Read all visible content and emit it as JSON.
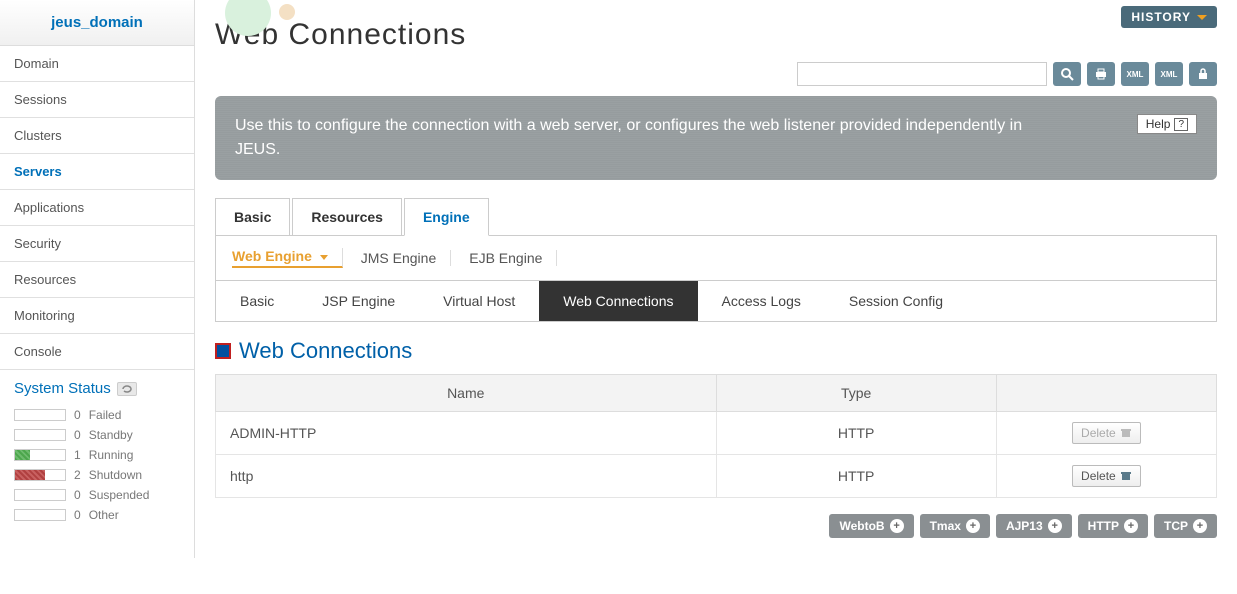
{
  "domain_name": "jeus_domain",
  "history_label": "HISTORY",
  "nav": {
    "items": [
      {
        "label": "Domain"
      },
      {
        "label": "Sessions"
      },
      {
        "label": "Clusters"
      },
      {
        "label": "Servers",
        "active": true
      },
      {
        "label": "Applications"
      },
      {
        "label": "Security"
      },
      {
        "label": "Resources"
      },
      {
        "label": "Monitoring"
      },
      {
        "label": "Console"
      }
    ]
  },
  "system_status": {
    "title": "System Status",
    "rows": [
      {
        "count": "0",
        "label": "Failed",
        "fill": ""
      },
      {
        "count": "0",
        "label": "Standby",
        "fill": ""
      },
      {
        "count": "1",
        "label": "Running",
        "fill": "running"
      },
      {
        "count": "2",
        "label": "Shutdown",
        "fill": "shutdown"
      },
      {
        "count": "0",
        "label": "Suspended",
        "fill": ""
      },
      {
        "count": "0",
        "label": "Other",
        "fill": ""
      }
    ]
  },
  "page_title": "Web Connections",
  "search": {
    "placeholder": ""
  },
  "info_text": "Use this to configure the connection with a web server, or configures the web listener provided independently in JEUS.",
  "help_label": "Help",
  "tabs_primary": [
    {
      "label": "Basic"
    },
    {
      "label": "Resources"
    },
    {
      "label": "Engine",
      "active": true
    }
  ],
  "tabs_engine": [
    {
      "label": "Web Engine",
      "active": true
    },
    {
      "label": "JMS Engine"
    },
    {
      "label": "EJB Engine"
    }
  ],
  "tabs_sub": [
    {
      "label": "Basic"
    },
    {
      "label": "JSP Engine"
    },
    {
      "label": "Virtual Host"
    },
    {
      "label": "Web Connections",
      "active": true
    },
    {
      "label": "Access Logs"
    },
    {
      "label": "Session Config"
    }
  ],
  "section_title": "Web Connections",
  "table": {
    "headers": [
      "Name",
      "Type",
      ""
    ],
    "rows": [
      {
        "name": "ADMIN-HTTP",
        "type": "HTTP",
        "delete_label": "Delete",
        "disabled": true
      },
      {
        "name": "http",
        "type": "HTTP",
        "delete_label": "Delete",
        "disabled": false
      }
    ]
  },
  "actions": [
    {
      "label": "WebtoB"
    },
    {
      "label": "Tmax"
    },
    {
      "label": "AJP13"
    },
    {
      "label": "HTTP"
    },
    {
      "label": "TCP"
    }
  ]
}
